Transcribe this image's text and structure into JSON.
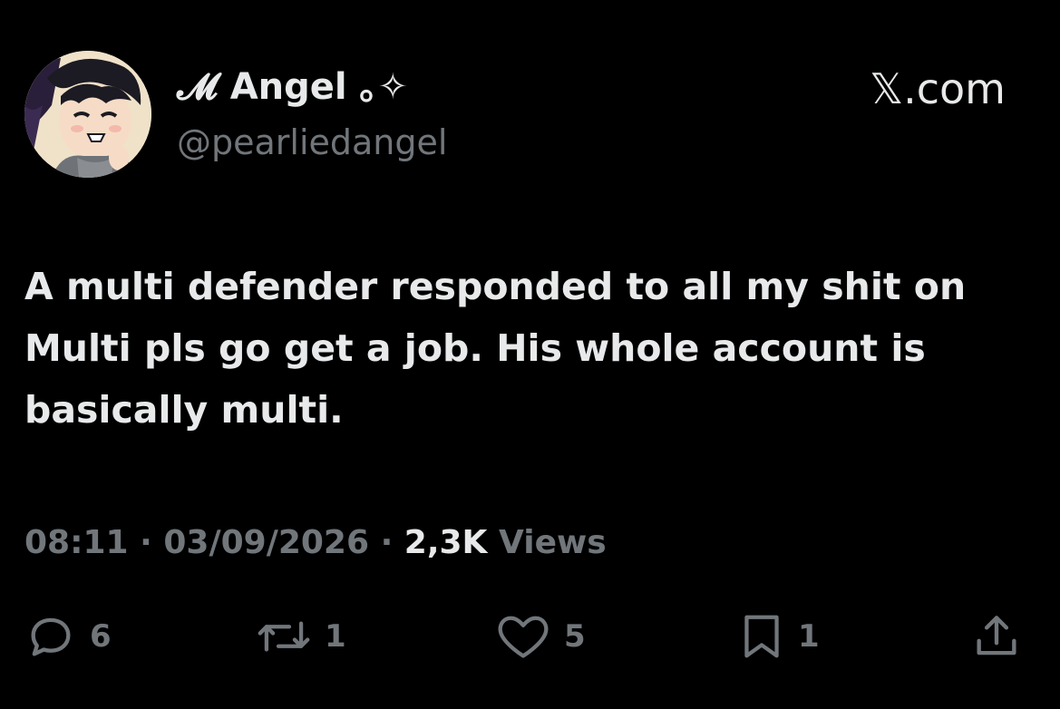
{
  "header": {
    "display_name": "𝓜 Angel ｡✧",
    "handle": "@pearliedangel",
    "brand": "𝕏.com"
  },
  "tweet": {
    "text": "A multi defender responded to all my shit on Multi pls go get a job. His whole account is basically multi.",
    "time": "08:11",
    "date": "03/09/2026",
    "views_count": "2,3K",
    "views_label": "Views",
    "separator": " · "
  },
  "actions": {
    "replies": "6",
    "reposts": "1",
    "likes": "5",
    "bookmarks": "1"
  },
  "colors": {
    "background": "#000000",
    "primary_text": "#e7e9ea",
    "secondary_text": "#71767b"
  }
}
